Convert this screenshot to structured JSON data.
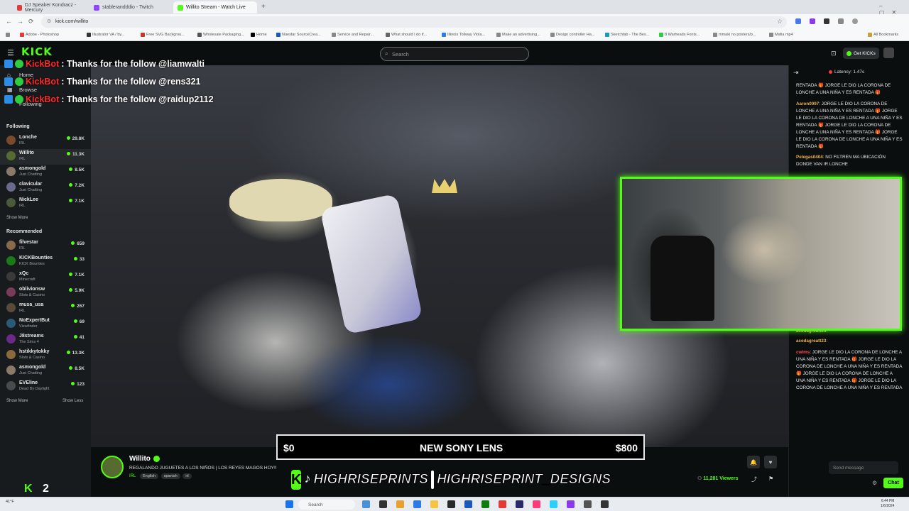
{
  "browser": {
    "tabs": [
      {
        "label": "DJ Speaker Kondracz - Mercury",
        "color": "#e53935"
      },
      {
        "label": "stablerandddio - Twitch",
        "color": "#9146ff"
      },
      {
        "label": "Willito Stream - Watch Live",
        "color": "#53fc18"
      }
    ],
    "url": "kick.com/willito",
    "bookmarks": [
      "Adobe - Photoshop",
      "Illustrator VA / by...",
      "Free SVG Backgrou...",
      "Wholesale Packaging...",
      "Home",
      "Nuestar SourceCrea...",
      "Service and Repair...",
      "What should I do if...",
      "Illinois Tollway Viola...",
      "Make an advertising...",
      "Design controller Ha...",
      "Sketchfab - The Bes...",
      "8 Warheads Fonts...",
      "mmaki no posters/p...",
      "Mafia mp4"
    ],
    "all_bookmarks": "All Bookmarks"
  },
  "header": {
    "logo": "KICK",
    "search_placeholder": "Search",
    "get_kicks": "Get KICKs"
  },
  "sidebar": {
    "nav": [
      "Home",
      "Browse",
      "Following"
    ],
    "following_title": "Following",
    "following": [
      {
        "name": "Lonche",
        "category": "IRL",
        "viewers": "29.8K",
        "color": "#7a4a2a"
      },
      {
        "name": "Willito",
        "category": "IRL",
        "viewers": "11.3K",
        "color": "#556b2f"
      },
      {
        "name": "asmongold",
        "category": "Just Chatting",
        "viewers": "8.5K",
        "color": "#8a7a6a"
      },
      {
        "name": "clavicular",
        "category": "Just Chatting",
        "viewers": "7.2K",
        "color": "#6a6a8a"
      },
      {
        "name": "NickLee",
        "category": "IRL",
        "viewers": "7.1K",
        "color": "#4a5a3a"
      }
    ],
    "show_more": "Show More",
    "recommended_title": "Recommended",
    "recommended": [
      {
        "name": "filvestar",
        "category": "IRL",
        "viewers": "659",
        "color": "#8a6a4a"
      },
      {
        "name": "KICKBounties",
        "category": "KICK Bounties",
        "viewers": "33",
        "color": "#1a7a1a"
      },
      {
        "name": "xQc",
        "category": "Minecraft",
        "viewers": "7.1K",
        "color": "#3a3a3a"
      },
      {
        "name": "oblivionsw",
        "category": "Slots & Casino",
        "viewers": "5.9K",
        "color": "#7a3a5a"
      },
      {
        "name": "musa_usa",
        "category": "IRL",
        "viewers": "267",
        "color": "#5a4a3a"
      },
      {
        "name": "NoExpertBut",
        "category": "Viewfinder",
        "viewers": "69",
        "color": "#2a5a7a"
      },
      {
        "name": "J8streams",
        "category": "The Sims 4",
        "viewers": "41",
        "color": "#6a2a8a"
      },
      {
        "name": "hstikkytokky",
        "category": "Slots & Casino",
        "viewers": "13.3K",
        "color": "#8a6a3a"
      },
      {
        "name": "asmongold",
        "category": "Just Chatting",
        "viewers": "8.5K",
        "color": "#8a7a6a"
      },
      {
        "name": "EVEline",
        "category": "Dead By Daylight",
        "viewers": "123",
        "color": "#4a4a4a"
      }
    ],
    "show_less": "Show Less",
    "bottom_count": "2"
  },
  "overlay": {
    "follows": [
      {
        "bot": "KickBot",
        "text": ": Thanks for the follow @liamwalti"
      },
      {
        "bot": "KickBot",
        "text": ": Thanks for the follow @rens321"
      },
      {
        "bot": "KickBot",
        "text": ": Thanks for the follow @raidup2112"
      }
    ],
    "donation": {
      "left": "$0",
      "center": "NEW SONY LENS",
      "right": "$800"
    },
    "promo1": "HIGHRISEPRINTS",
    "promo2": "HIGHRISEPRINT_DESIGNS"
  },
  "stream": {
    "streamer": "Willito",
    "title": "REGALANDO JUGUETES A LOS NIÑOS | LOS REYES MAGOS HOY!!",
    "tags": [
      "IRL",
      "English",
      "spanish",
      "irl"
    ],
    "viewers": "11,281 Viewers"
  },
  "chat": {
    "latency": "Latency: 1.47s",
    "messages": [
      {
        "user": "",
        "text": "RENTADA 🎁 JORGE LE DIO LA CORONA DE LONCHE A UNA NIÑA Y ES RENTADA 🎁",
        "color": "#e8e8e8"
      },
      {
        "user": "Aaron0097",
        "text": ": JORGE LE DIO LA CORONA DE LONCHE A UNA NIÑA Y ES RENTADA 🎁 JORGE LE DIO LA CORONA DE LONCHE A UNA NIÑA Y ES RENTADA 🎁 JORGE LE DIO LA CORONA DE LONCHE A UNA NIÑA Y ES RENTADA 🎁 JORGE LE DIO LA CORONA DE LONCHE A UNA NIÑA Y ES RENTADA 🎁",
        "color": "#e8b04a"
      },
      {
        "user": "Pelegas0404",
        "text": ": NO FILTREN MA UBICACIÓN DONDE VAN IR LONCHE",
        "color": "#e8b04a"
      },
      {
        "user": "acedagreatt23",
        "text": ":",
        "color": "#e8b04a"
      },
      {
        "user": "acedagreatt23",
        "text": ":",
        "color": "#e8b04a"
      },
      {
        "user": "cwlms",
        "text": ": JORGE LE DIO LA CORONA DE LONCHE A UNA NIÑA Y ES RENTADA 🎁 JORGE LE DIO LA CORONA DE LONCHE A UNA NIÑA Y ES RENTADA 🎁 JORGE LE DIO LA CORONA DE LONCHE A UNA NIÑA Y ES RENTADA 🎁 JORGE LE DIO LA CORONA DE LONCHE A UNA NIÑA Y ES RENTADA",
        "color": "#ff4a4a"
      }
    ],
    "input_placeholder": "Send message",
    "chat_button": "Chat"
  },
  "taskbar": {
    "search": "Search",
    "time": "6:44 PM",
    "date": "1/6/2024",
    "weather": "41°F"
  }
}
